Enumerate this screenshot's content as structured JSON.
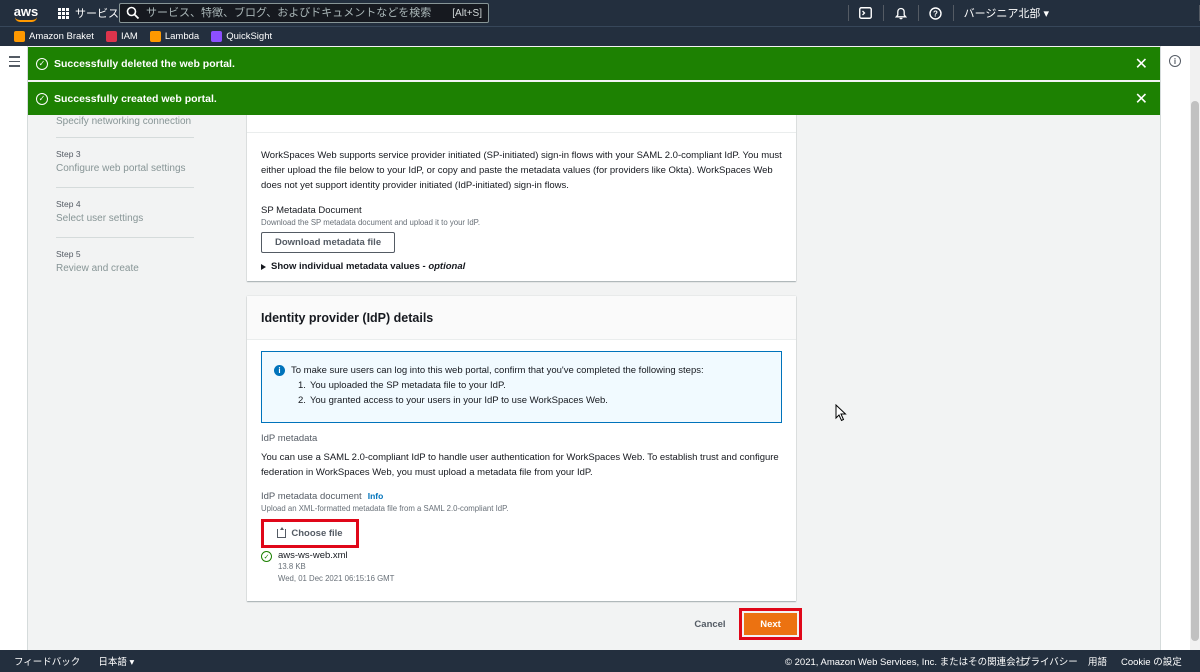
{
  "topnav": {
    "logo": "aws",
    "services_label": "サービス",
    "search_placeholder": "サービス、特徴、ブログ、およびドキュメントなどを検索",
    "search_shortcut": "[Alt+S]",
    "region": "バージニア北部 ▾"
  },
  "favorites": [
    {
      "label": "Amazon Braket",
      "color": "#ff9900"
    },
    {
      "label": "IAM",
      "color": "#dd344c"
    },
    {
      "label": "Lambda",
      "color": "#ff9900"
    },
    {
      "label": "QuickSight",
      "color": "#8c4fff"
    }
  ],
  "flash": [
    {
      "message": "Successfully deleted the web portal."
    },
    {
      "message": "Successfully created web portal."
    }
  ],
  "steps": {
    "partial_label": "Specify networking connection",
    "items": [
      {
        "num": "Step 3",
        "label": "Configure web portal settings"
      },
      {
        "num": "Step 4",
        "label": "Select user settings"
      },
      {
        "num": "Step 5",
        "label": "Review and create"
      }
    ]
  },
  "sp_panel": {
    "description": "WorkSpaces Web supports service provider initiated (SP-initiated) sign-in flows with your SAML 2.0-compliant IdP. You must either upload the file below to your IdP, or copy and paste the metadata values (for providers like Okta). WorkSpaces Web does not yet support identity provider initiated (IdP-initiated) sign-in flows.",
    "doc_label": "SP Metadata Document",
    "doc_desc": "Download the SP metadata document and upload it to your IdP.",
    "download_button": "Download metadata file",
    "expander_label": "Show individual metadata values - ",
    "expander_optional": "optional"
  },
  "idp_panel": {
    "title": "Identity provider (IdP) details",
    "alert_intro": "To make sure users can log into this web portal, confirm that you've completed the following steps:",
    "alert_steps": [
      {
        "n": "1.",
        "text": "You uploaded the SP metadata file to your IdP."
      },
      {
        "n": "2.",
        "text": "You granted access to your users in your IdP to use WorkSpaces Web."
      }
    ],
    "metadata_label": "IdP metadata",
    "metadata_desc": "You can use a SAML 2.0-compliant IdP to handle user authentication for WorkSpaces Web. To establish trust and configure federation in WorkSpaces Web, you must upload a metadata file from your IdP.",
    "doc_label": "IdP metadata document",
    "info_link": "Info",
    "doc_desc": "Upload an XML-formatted metadata file from a SAML 2.0-compliant IdP.",
    "choose_button": "Choose file",
    "file": {
      "name": "aws-ws-web.xml",
      "size": "13.8 KB",
      "modified": "Wed, 01 Dec 2021 06:15:16 GMT"
    }
  },
  "actions": {
    "cancel": "Cancel",
    "next": "Next"
  },
  "footer": {
    "feedback": "フィードバック",
    "language": "日本語 ▾",
    "copyright": "© 2021, Amazon Web Services, Inc. またはその関連会社。",
    "privacy": "プライバシー",
    "terms": "用語",
    "cookies": "Cookie の設定"
  }
}
